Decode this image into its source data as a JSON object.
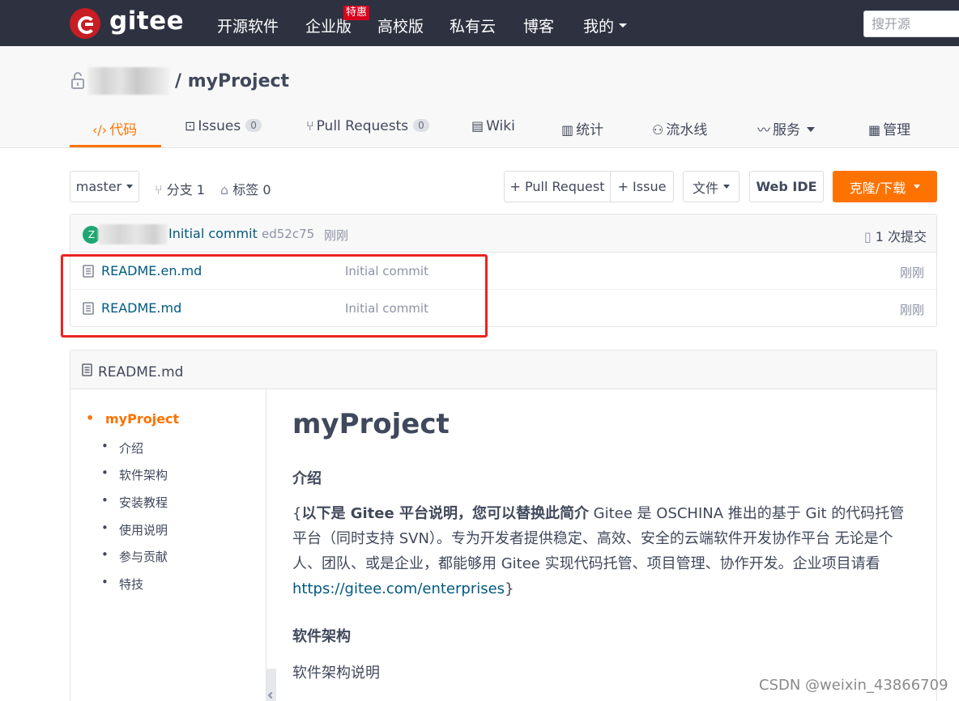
{
  "nav": {
    "brand": "gitee",
    "items": [
      "开源软件",
      "企业版",
      "高校版",
      "私有云",
      "博客",
      "我的"
    ],
    "badge": "特惠",
    "search_placeholder": "搜开源"
  },
  "repo": {
    "title": "/ myProject",
    "tabs": [
      {
        "label": "代码",
        "icon": "code-icon"
      },
      {
        "label": "Issues",
        "count": "0",
        "icon": "issues-icon"
      },
      {
        "label": "Pull Requests",
        "count": "0",
        "icon": "pull-request-icon"
      },
      {
        "label": "Wiki",
        "icon": "wiki-icon"
      },
      {
        "label": "统计",
        "icon": "stats-icon"
      },
      {
        "label": "流水线",
        "icon": "pipeline-icon"
      },
      {
        "label": "服务",
        "icon": "service-icon"
      },
      {
        "label": "管理",
        "icon": "manage-icon"
      }
    ]
  },
  "toolbar": {
    "branch": "master",
    "branches": "分支 1",
    "tags": "标签 0",
    "pull_request": "+ Pull Request",
    "issue": "+ Issue",
    "file": "文件",
    "web_ide": "Web IDE",
    "clone": "克隆/下载"
  },
  "commit": {
    "avatar_letter": "Z",
    "message": "Initial commit",
    "sha": "ed52c75",
    "time": "刚刚",
    "count": "1 次提交"
  },
  "files": [
    {
      "name": "README.en.md",
      "commit": "Initial commit",
      "time": "刚刚"
    },
    {
      "name": "README.md",
      "commit": "Initial commit",
      "time": "刚刚"
    }
  ],
  "readme": {
    "filename": "README.md",
    "toc": [
      "myProject",
      "介绍",
      "软件架构",
      "安装教程",
      "使用说明",
      "参与贡献",
      "特技"
    ],
    "h1": "myProject",
    "h_intro": "介绍",
    "intro_prefix": "{",
    "intro_bold": "以下是 Gitee 平台说明，您可以替换此简介",
    "intro_text": " Gitee 是 OSCHINA 推出的基于 Git 的代码托管平台（同时支持 SVN）。专为开发者提供稳定、高效、安全的云端软件开发协作平台 无论是个人、团队、或是企业，都能够用 Gitee 实现代码托管、项目管理、协作开发。企业项目请看 ",
    "intro_link": "https://gitee.com/enterprises",
    "intro_suffix": "}",
    "h_arch": "软件架构",
    "arch_text": "软件架构说明"
  },
  "watermark": "CSDN @weixin_43866709",
  "colors": {
    "accent": "#fe7300",
    "nav_bg": "#2e3240",
    "link": "#005980",
    "highlight": "#ea2420"
  }
}
